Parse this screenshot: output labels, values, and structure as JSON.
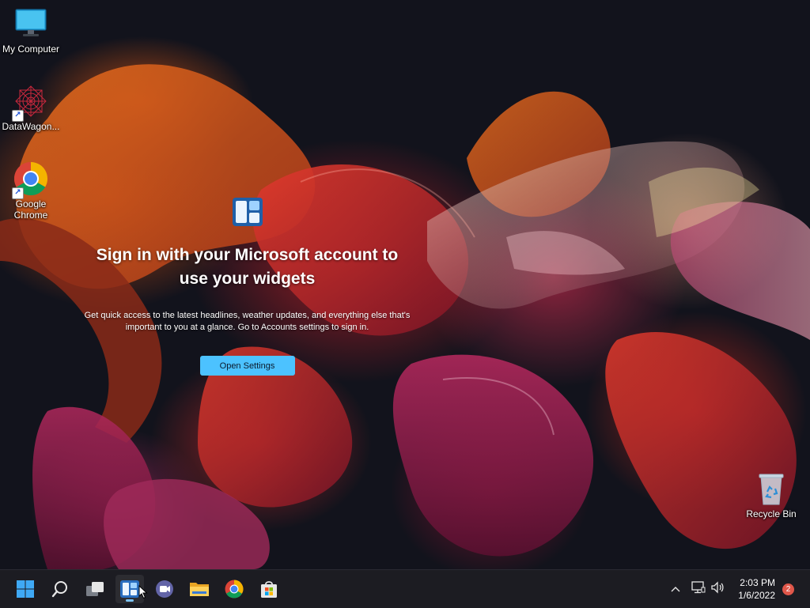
{
  "desktop": {
    "icons": [
      {
        "label": "My Computer",
        "icon": "monitor-icon"
      },
      {
        "label": "DataWagon...",
        "icon": "datawagon-app-icon"
      },
      {
        "label": "Google\nChrome",
        "icon": "chrome-icon"
      },
      {
        "label": "Recycle Bin",
        "icon": "recycle-bin-icon"
      }
    ]
  },
  "widgets": {
    "title_line1": "Sign in with your Microsoft account to",
    "title_line2": "use your widgets",
    "desc_line1": "Get quick access to the latest headlines, weather updates, and everything else that's",
    "desc_line2": "important to you at a glance. Go to Accounts settings to sign in.",
    "button_label": "Open Settings",
    "accent": "#4cc2ff"
  },
  "taskbar": {
    "apps": [
      {
        "name": "start",
        "icon": "windows-start-icon"
      },
      {
        "name": "search",
        "icon": "search-icon"
      },
      {
        "name": "task-view",
        "icon": "task-view-icon"
      },
      {
        "name": "widgets",
        "icon": "widgets-icon",
        "active": true
      },
      {
        "name": "chat",
        "icon": "teams-chat-icon"
      },
      {
        "name": "file-explorer",
        "icon": "folder-icon"
      },
      {
        "name": "chrome",
        "icon": "chrome-icon"
      },
      {
        "name": "store",
        "icon": "store-icon"
      }
    ],
    "tray": {
      "time": "2:03 PM",
      "date": "1/6/2022",
      "notification_count": "2"
    }
  }
}
